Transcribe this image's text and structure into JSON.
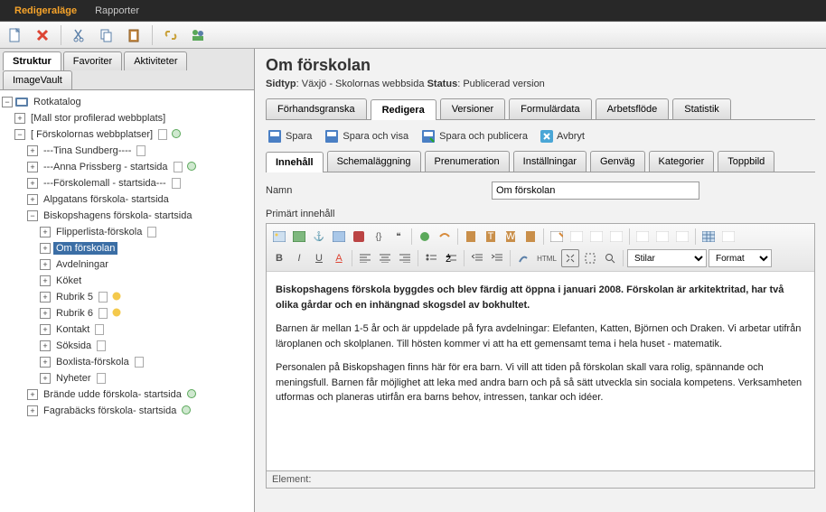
{
  "menubar": {
    "items": [
      "Redigeraläge",
      "Rapporter"
    ],
    "active": 0
  },
  "left_tabs": {
    "row1": [
      "Struktur",
      "Favoriter",
      "Aktiviteter"
    ],
    "row1_active": 0,
    "row2": [
      "ImageVault"
    ]
  },
  "tree": {
    "root": "Rotkatalog",
    "n1": "[Mall stor profilerad webbplats]",
    "n2": "[ Förskolornas webbplatser]",
    "c": [
      "---Tina Sundberg----",
      "---Anna Prissberg - startsida",
      "---Förskolemall - startsida---",
      "Alpgatans förskola- startsida",
      "Biskopshagens förskola- startsida"
    ],
    "bisk": [
      "Flipperlista-förskola",
      "Om förskolan",
      "Avdelningar",
      "Köket",
      "Rubrik 5",
      "Rubrik 6",
      "Kontakt",
      "Söksida",
      "Boxlista-förskola",
      "Nyheter"
    ],
    "after": [
      "Brände udde förskola- startsida",
      "Fagrabäcks förskola- startsida"
    ],
    "selected": "Om förskolan"
  },
  "header": {
    "title": "Om förskolan",
    "sidtyp_lbl": "Sidtyp",
    "sidtyp_val": "Växjö - Skolornas webbsida",
    "status_lbl": "Status",
    "status_val": "Publicerad version"
  },
  "view_tabs": [
    "Förhandsgranska",
    "Redigera",
    "Versioner",
    "Formulärdata",
    "Arbetsflöde",
    "Statistik"
  ],
  "view_active": 1,
  "actions": {
    "save": "Spara",
    "save_view": "Spara och visa",
    "save_pub": "Spara och publicera",
    "cancel": "Avbryt"
  },
  "content_tabs": [
    "Innehåll",
    "Schemaläggning",
    "Prenumeration",
    "Inställningar",
    "Genväg",
    "Kategorier",
    "Toppbild"
  ],
  "content_active": 0,
  "form": {
    "name_lbl": "Namn",
    "name_val": "Om förskolan",
    "primary_lbl": "Primärt innehåll"
  },
  "rte": {
    "styles_lbl": "Stilar",
    "format_lbl": "Format",
    "p1": "Biskopshagens förskola byggdes och blev färdig att öppna i januari 2008. Förskolan är arkitektritad, har två olika gårdar och en inhängnad skogsdel av bokhultet.",
    "p2": "Barnen är mellan 1-5 år och är uppdelade på fyra avdelningar: Elefanten, Katten, Björnen och Draken. Vi arbetar utifrån läroplanen och skolplanen. Till hösten kommer vi att ha ett gemensamt tema i hela huset - matematik.",
    "p3": "Personalen på Biskopshagen finns här för era barn. Vi vill att tiden på förskolan skall vara rolig, spännande och meningsfull. Barnen får möjlighet att leka med andra barn och på så sätt utveckla sin sociala kompetens. Verksamheten utformas och planeras utirfån era barns behov, intressen, tankar och idéer."
  },
  "element_bar": "Element:"
}
